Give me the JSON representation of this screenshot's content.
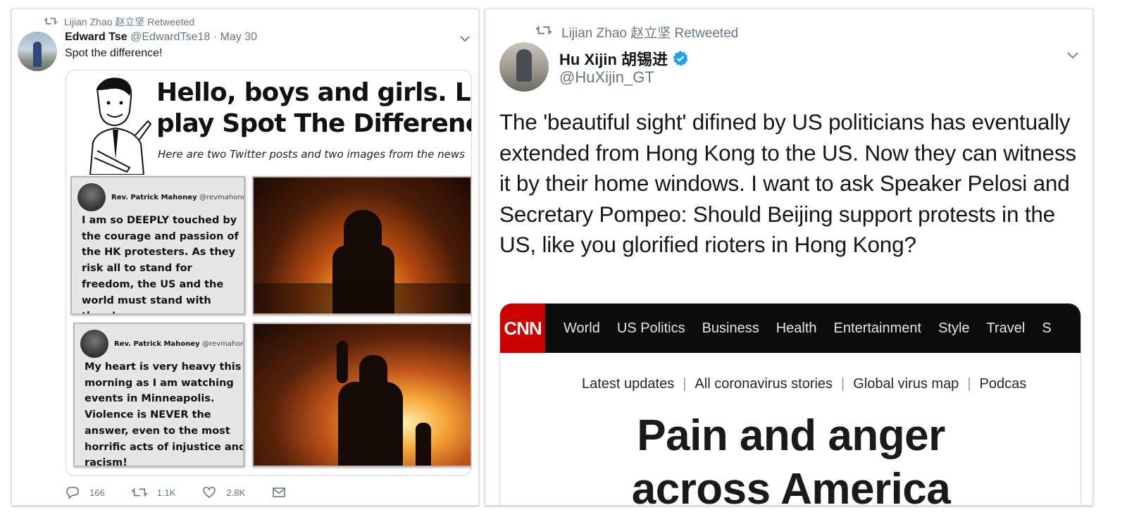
{
  "left_tweet": {
    "retweet_text": "Lijian Zhao 赵立坚 Retweeted",
    "author_name": "Edward Tse",
    "author_handle": "@EdwardTse18",
    "separator": "·",
    "date": "May 30",
    "text": "Spot the difference!",
    "meme": {
      "title_line1": "Hello, boys and girls. Let’s",
      "title_line2": "play Spot The Difference!",
      "subtitle": "Here are two Twitter posts and two images from the news",
      "tweet1": {
        "name": "Rev. Patrick Mahoney",
        "handle": "@revmahoney",
        "body": "I am so DEEPLY touched by the courage and passion of the HK protesters. As they risk all to stand for freedom, the US and the world must stand with them!"
      },
      "tweet2": {
        "name": "Rev. Patrick Mahoney",
        "handle": "@revmahoney",
        "body": "My heart is very heavy this morning as I am watching events in Minneapolis. Violence is NEVER the answer, even to the most horrific acts of injustice and racism!"
      }
    },
    "actions": {
      "replies": "166",
      "retweets": "1.1K",
      "likes": "2.8K"
    }
  },
  "right_tweet": {
    "retweet_text": "Lijian Zhao 赵立坚 Retweeted",
    "author_name": "Hu Xijin 胡锡进",
    "author_handle": "@HuXijin_GT",
    "text": "The 'beautiful sight' difined by US politicians has eventually extended from Hong Kong to the US. Now they can witness it by their home windows. I want to ask Speaker Pelosi and Secretary Pompeo: Should Beijing support protests in the US, like you glorified rioters in Hong Kong?",
    "cnn": {
      "logo": "CNN",
      "nav": [
        "World",
        "US Politics",
        "Business",
        "Health",
        "Entertainment",
        "Style",
        "Travel",
        "S"
      ],
      "sub_nav": [
        "Latest updates",
        "All coronavirus stories",
        "Global virus map",
        "Podcas"
      ],
      "sub_separator": "|",
      "headline_line1": "Pain and anger",
      "headline_line2": "across America"
    }
  },
  "colors": {
    "muted": "#657786",
    "verified": "#1da1f2",
    "cnn_red": "#cc0000"
  },
  "icons": [
    "retweet-icon",
    "chevron-down-icon",
    "reply-icon",
    "like-icon",
    "mail-icon",
    "verified-icon"
  ]
}
